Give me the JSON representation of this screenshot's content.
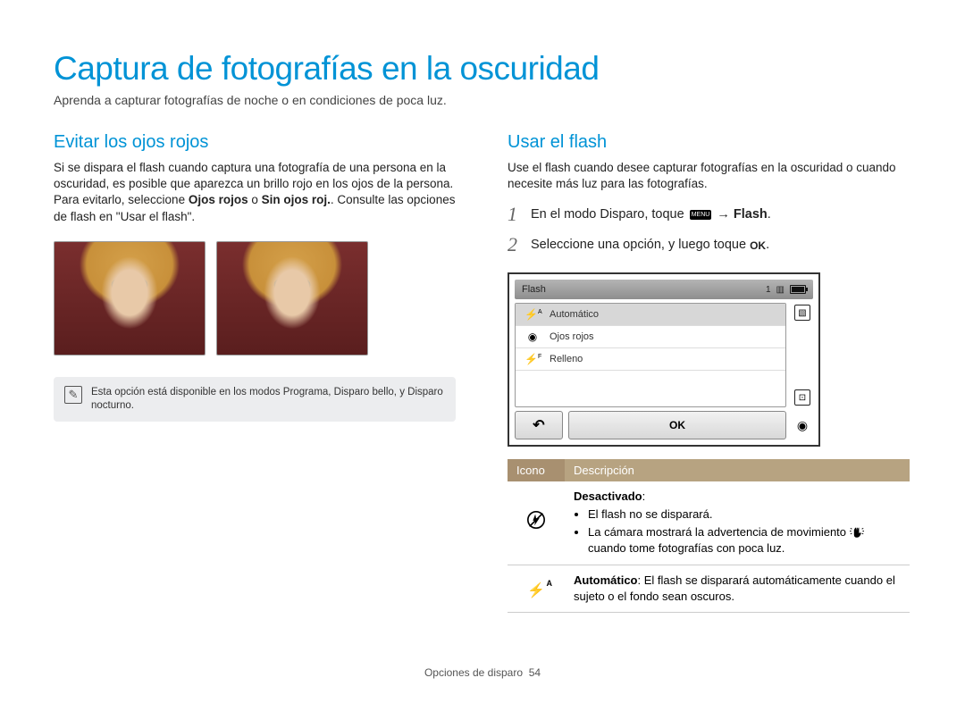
{
  "title": "Captura de fotografías en la oscuridad",
  "subtitle": "Aprenda a capturar fotografías de noche o en condiciones de poca luz.",
  "left": {
    "heading": "Evitar los ojos rojos",
    "para_part1": "Si se dispara el flash cuando captura una fotografía de una persona en la oscuridad, es posible que aparezca un brillo rojo en los ojos de la persona. Para evitarlo, seleccione ",
    "bold1": "Ojos rojos",
    "mid1": " o ",
    "bold2": "Sin ojos roj.",
    "para_part2": ". Consulte las opciones de flash en \"Usar el flash\".",
    "note": "Esta opción está disponible en los modos Programa, Disparo bello, y Disparo nocturno."
  },
  "right": {
    "heading": "Usar el flash",
    "para": "Use el flash cuando desee capturar fotografías en la oscuridad o cuando necesite más luz para las fotografías.",
    "step1_num": "1",
    "step1_pre": "En el modo Disparo, toque ",
    "step1_menu": "MENU",
    "step1_arrow": " → ",
    "step1_bold": "Flash",
    "step1_post": ".",
    "step2_num": "2",
    "step2_pre": "Seleccione una opción, y luego toque ",
    "step2_ok": "OK",
    "step2_post": ".",
    "cam": {
      "title": "Flash",
      "count": "1",
      "items": [
        "Automático",
        "Ojos rojos",
        "Relleno"
      ],
      "ok": "OK"
    },
    "table": {
      "h1": "Icono",
      "h2": "Descripción",
      "row1": {
        "title": "Desactivado",
        "b1": "El flash no se disparará.",
        "b2a": "La cámara mostrará la advertencia de movimiento ",
        "b2b": " cuando tome fotografías con poca luz."
      },
      "row2": {
        "bold": "Automático",
        "text": ": El flash se disparará automáticamente cuando el sujeto o el fondo sean oscuros."
      }
    }
  },
  "footer": {
    "section": "Opciones de disparo",
    "page": "54"
  }
}
